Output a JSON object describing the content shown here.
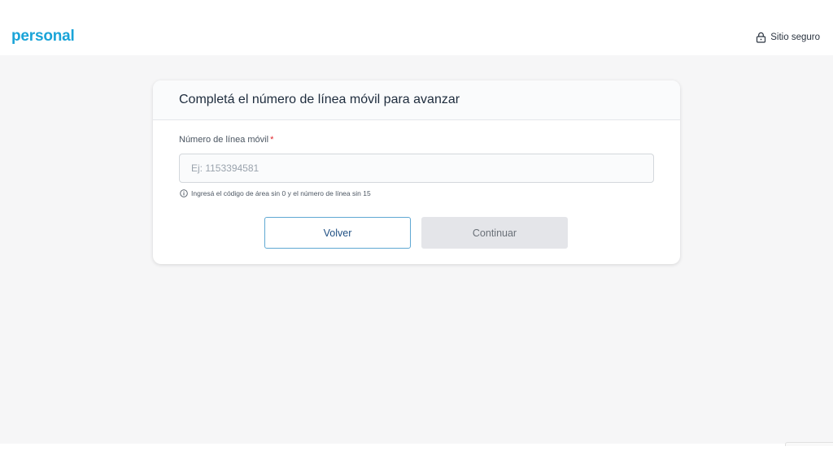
{
  "header": {
    "logo_text": "personal",
    "secure_label": "Sitio seguro",
    "secure_icon": "lock-icon"
  },
  "form": {
    "title": "Completá el número de línea móvil para avanzar",
    "field_label": "Número de línea móvil",
    "required_mark": "*",
    "phone_value": "",
    "phone_placeholder": "Ej: 1153394581",
    "hint_icon": "info-icon",
    "hint_text": "Ingresá el código de área sin 0 y el número de línea sin 15",
    "back_label": "Volver",
    "continue_label": "Continuar",
    "continue_enabled": false
  },
  "colors": {
    "brand": "#1aa4d8",
    "required": "#e0242b",
    "back_border": "#5fa8d3",
    "back_text": "#1f4f83",
    "disabled_bg": "#e4e5e9",
    "page_bg": "#f6f6f7"
  }
}
